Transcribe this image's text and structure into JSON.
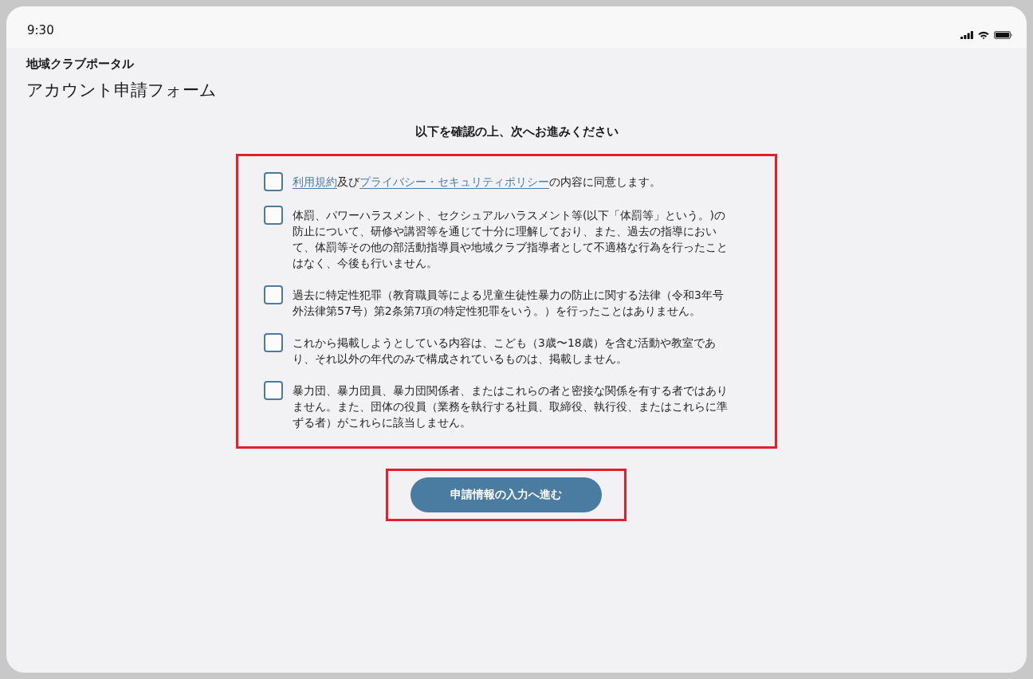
{
  "status_bar": {
    "time": "9:30"
  },
  "header": {
    "app_name": "地域クラブポータル",
    "title": "アカウント申請フォーム"
  },
  "form": {
    "instruction": "以下を確認の上、次へお進みください",
    "highlighted": true,
    "agreements": [
      {
        "checked": false,
        "parts": [
          {
            "kind": "link",
            "text": "利用規約"
          },
          {
            "kind": "text",
            "text": "及び"
          },
          {
            "kind": "link",
            "text": "プライバシー・セキュリティポリシー"
          },
          {
            "kind": "text",
            "text": "の内容に同意します。"
          }
        ]
      },
      {
        "checked": false,
        "parts": [
          {
            "kind": "text",
            "text": "体罰、パワーハラスメント、セクシュアルハラスメント等(以下「体罰等」という。)の防止について、研修や講習等を通じて十分に理解しており、また、過去の指導において、体罰等その他の部活動指導員や地域クラブ指導者として不適格な行為を行ったことはなく、今後も行いません。"
          }
        ]
      },
      {
        "checked": false,
        "parts": [
          {
            "kind": "text",
            "text": "過去に特定性犯罪（教育職員等による児童生徒性暴力の防止に関する法律（令和3年号外法律第57号）第2条第7項の特定性犯罪をいう。）を行ったことはありません。"
          }
        ]
      },
      {
        "checked": false,
        "parts": [
          {
            "kind": "text",
            "text": "これから掲載しようとしている内容は、こども（3歳〜18歳）を含む活動や教室であり、それ以外の年代のみで構成されているものは、掲載しません。"
          }
        ]
      },
      {
        "checked": false,
        "parts": [
          {
            "kind": "text",
            "text": "暴力団、暴力団員、暴力団関係者、またはこれらの者と密接な関係を有する者ではありません。また、団体の役員（業務を執行する社員、取締役、執行役、またはこれらに準ずる者）がこれらに該当しません。"
          }
        ]
      }
    ]
  },
  "submit": {
    "label": "申請情報の入力へ進む",
    "highlighted": true
  }
}
